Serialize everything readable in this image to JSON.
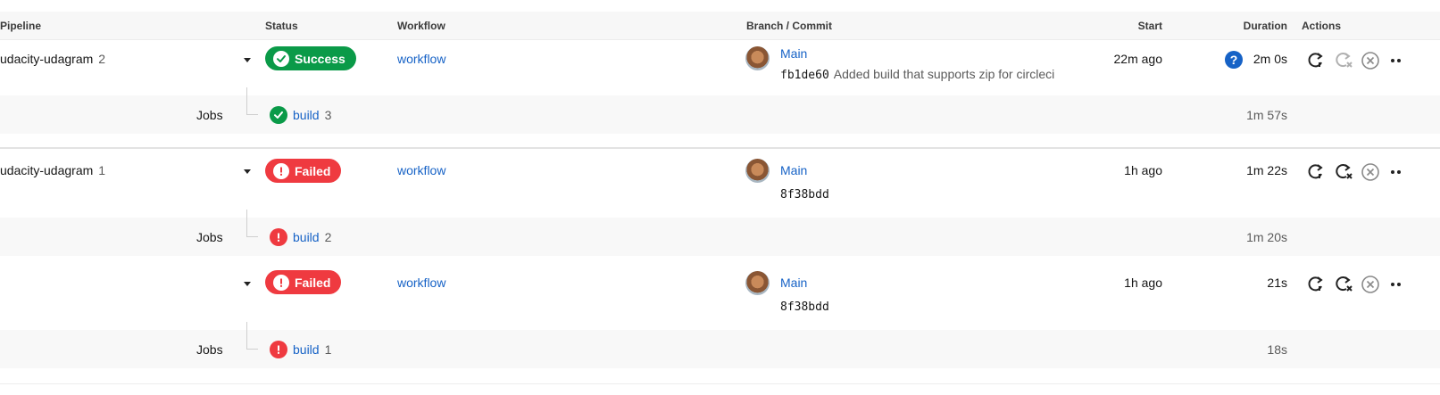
{
  "headers": {
    "pipeline": "Pipeline",
    "status": "Status",
    "workflow": "Workflow",
    "branch_commit": "Branch / Commit",
    "start": "Start",
    "duration": "Duration",
    "actions": "Actions"
  },
  "pipelines": [
    {
      "name": "udacity-udagram",
      "number": "2",
      "status": "Success",
      "status_type": "success",
      "workflow": "workflow",
      "branch": "Main",
      "commit_hash": "fb1de60",
      "commit_message": "Added build that supports zip for circleci",
      "start": "22m ago",
      "duration": "2m 0s",
      "help": "?",
      "jobs_label": "Jobs",
      "job": {
        "name": "build",
        "number": "3",
        "duration": "1m 57s",
        "status_type": "success"
      }
    },
    {
      "name": "udacity-udagram",
      "number": "1",
      "status": "Failed",
      "status_type": "failed",
      "workflow": "workflow",
      "branch": "Main",
      "commit_hash": "8f38bdd",
      "commit_message": "",
      "start": "1h ago",
      "duration": "1m 22s",
      "jobs_label": "Jobs",
      "job": {
        "name": "build",
        "number": "2",
        "duration": "1m 20s",
        "status_type": "failed"
      }
    },
    {
      "name": "",
      "number": "",
      "status": "Failed",
      "status_type": "failed",
      "workflow": "workflow",
      "branch": "Main",
      "commit_hash": "8f38bdd",
      "commit_message": "",
      "start": "1h ago",
      "duration": "21s",
      "jobs_label": "Jobs",
      "job": {
        "name": "build",
        "number": "1",
        "duration": "18s",
        "status_type": "failed"
      }
    }
  ],
  "icons": {
    "rerun": "rerun-icon",
    "rerun_failed": "rerun-failed-icon",
    "cancel": "cancel-icon",
    "more": "more-icon",
    "success": "check-icon",
    "failed": "exclamation-icon"
  },
  "colors": {
    "success": "#0a9a48",
    "failed": "#ef3a40",
    "link": "#1662c6"
  }
}
